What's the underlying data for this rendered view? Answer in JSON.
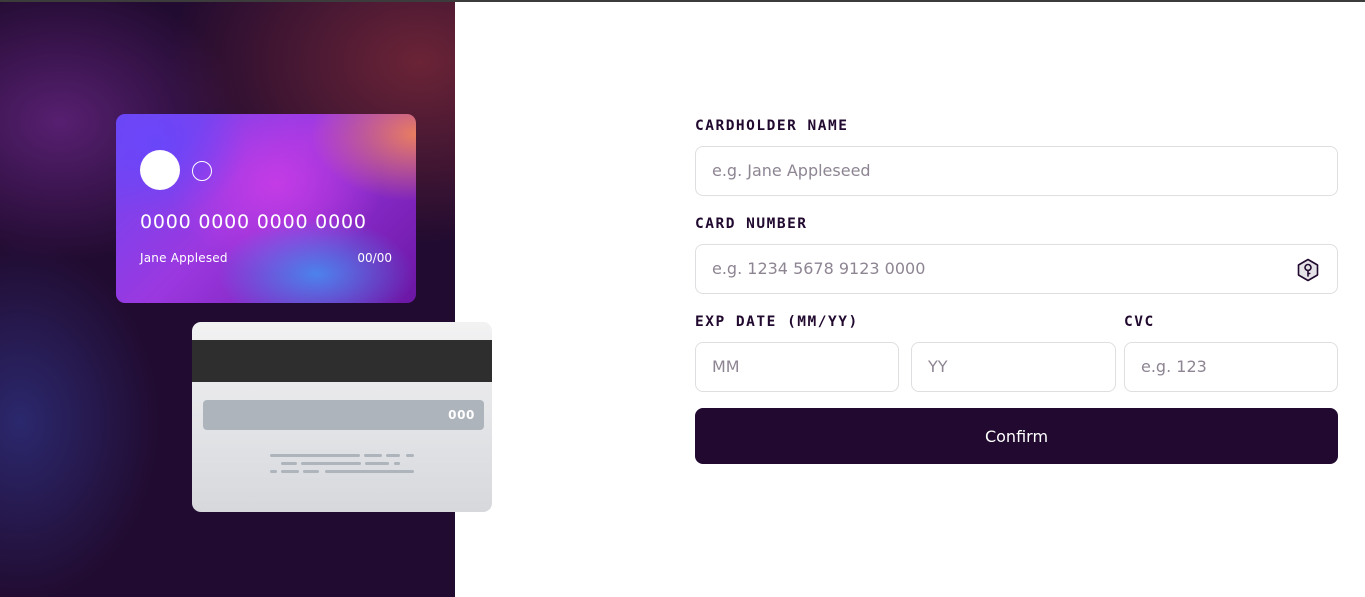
{
  "card_preview": {
    "number": "0000 0000 0000 0000",
    "name": "Jane Applesed",
    "expiry": "00/00",
    "cvc": "000"
  },
  "form": {
    "cardholder": {
      "label": "CARDHOLDER NAME",
      "placeholder": "e.g. Jane Appleseed"
    },
    "card_number": {
      "label": "CARD NUMBER",
      "placeholder": "e.g. 1234 5678 9123 0000",
      "icon": "key-icon"
    },
    "exp_date": {
      "label": "EXP DATE (MM/YY)",
      "mm_placeholder": "MM",
      "yy_placeholder": "YY"
    },
    "cvc": {
      "label": "CVC",
      "placeholder": "e.g. 123"
    },
    "confirm_label": "Confirm"
  },
  "colors": {
    "dark_violet": "#21092f",
    "border": "#dfdee0",
    "placeholder": "#8e8593"
  }
}
